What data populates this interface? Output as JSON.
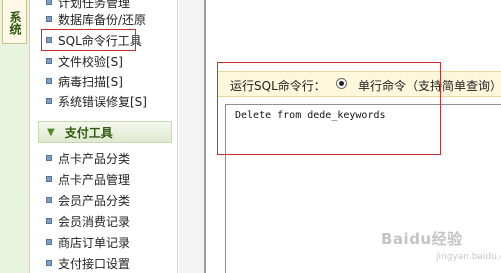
{
  "vertical_tab": {
    "label": "系统"
  },
  "sidebar": {
    "items_top": [
      {
        "label": "计划任务管理"
      },
      {
        "label": "数据库备份/还原"
      },
      {
        "label": "SQL命令行工具"
      },
      {
        "label": "文件校验[S]"
      },
      {
        "label": "病毒扫描[S]"
      },
      {
        "label": "系统错误修复[S]"
      }
    ],
    "section": {
      "label": "支付工具"
    },
    "items_bottom": [
      {
        "label": "点卡产品分类"
      },
      {
        "label": "点卡产品管理"
      },
      {
        "label": "会员产品分类"
      },
      {
        "label": "会员消费记录"
      },
      {
        "label": "商店订单记录"
      },
      {
        "label": "支付接口设置"
      }
    ]
  },
  "sql_tool": {
    "run_label": "运行SQL命令行：",
    "mode_label": "单行命令（支持简单查询）",
    "command_text": "Delete from dede_keywords"
  },
  "watermark": {
    "text": "Baidu经验",
    "subtext": "jingyan.baidu.com"
  }
}
